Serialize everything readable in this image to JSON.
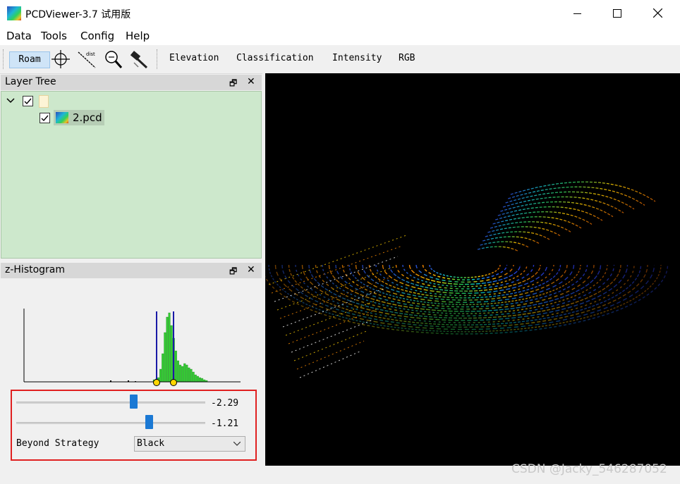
{
  "window": {
    "title": "PCDViewer-3.7 试用版",
    "minimize_glyph": "",
    "maximize_glyph": "",
    "close_glyph": ""
  },
  "menu": [
    "Data",
    "Tools",
    "Config",
    "Help"
  ],
  "toolbar": {
    "roam_label": "Roam",
    "tools": [
      "crosshair-icon",
      "distance-icon",
      "zoom-icon",
      "hammer-icon"
    ],
    "distance_icon_text": "dist",
    "color_modes": [
      "Elevation",
      "Classification",
      "Intensity",
      "RGB"
    ]
  },
  "layer_tree": {
    "title": "Layer Tree",
    "root_checked": true,
    "file_label": "2.pcd",
    "file_checked": true
  },
  "histogram": {
    "title": "z-Histogram",
    "lower_value": "-2.29",
    "upper_value": "-1.21",
    "lower_slider_fraction": 0.62,
    "upper_slider_fraction": 0.7,
    "strategy_label": "Beyond Strategy",
    "strategy_value": "Black",
    "bar_color": "#33cc33",
    "marker_color": "#1a1aa6"
  },
  "viewport": {
    "background": "#000000"
  },
  "watermark": "CSDN @Jacky_546287052"
}
